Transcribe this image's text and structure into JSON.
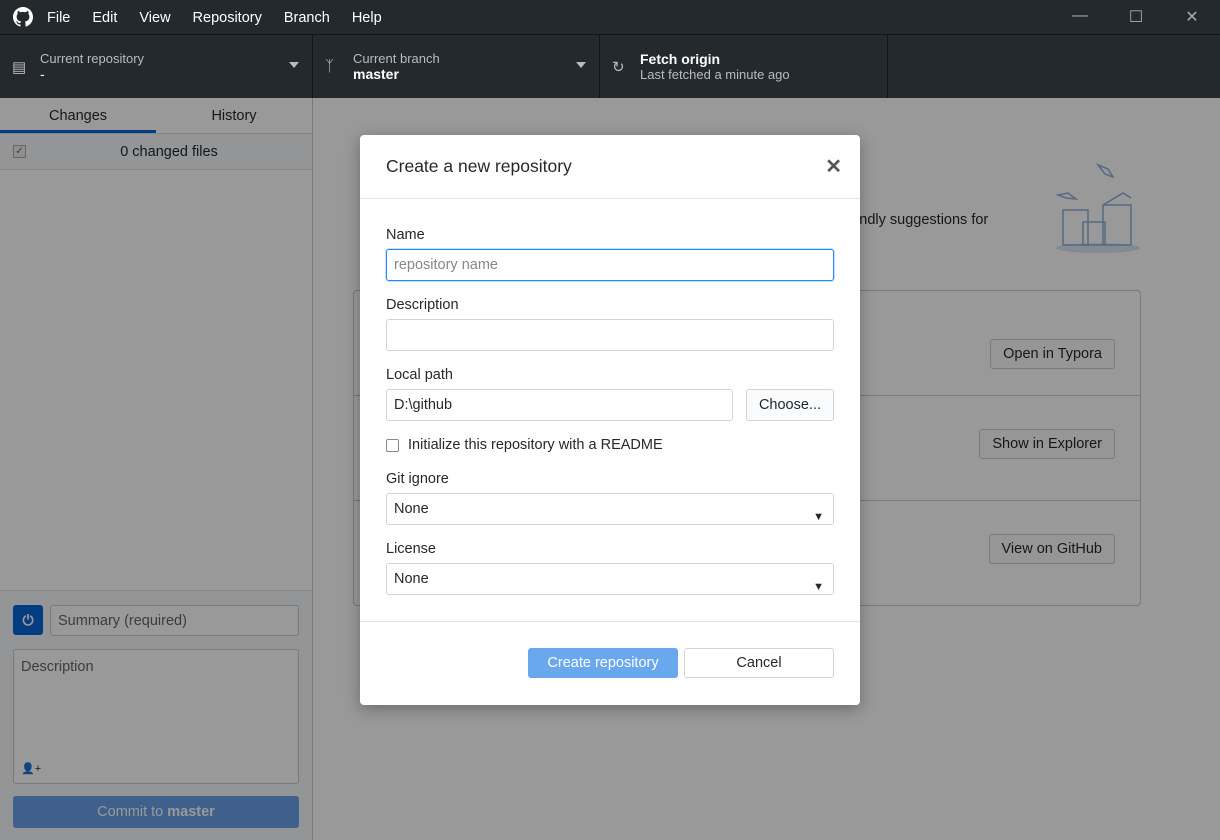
{
  "menu": [
    "File",
    "Edit",
    "View",
    "Repository",
    "Branch",
    "Help"
  ],
  "toolbar": {
    "repo": {
      "label": "Current repository",
      "value": "-"
    },
    "branch": {
      "label": "Current branch",
      "value": "master"
    },
    "fetch": {
      "label": "Fetch origin",
      "value": "Last fetched a minute ago"
    }
  },
  "sidebar": {
    "tabs": [
      "Changes",
      "History"
    ],
    "changed_files": "0 changed files",
    "summary_placeholder": "Summary (required)",
    "description_placeholder": "Description",
    "commit_prefix": "Commit to ",
    "commit_branch": "master"
  },
  "main": {
    "hint": "iendly suggestions for",
    "actions": [
      "Open in Typora",
      "Show in Explorer",
      "View on GitHub"
    ]
  },
  "dialog": {
    "title": "Create a new repository",
    "name_label": "Name",
    "name_placeholder": "repository name",
    "description_label": "Description",
    "path_label": "Local path",
    "path_value": "D:\\github",
    "choose": "Choose...",
    "readme": "Initialize this repository with a README",
    "gitignore_label": "Git ignore",
    "gitignore_value": "None",
    "license_label": "License",
    "license_value": "None",
    "create": "Create repository",
    "cancel": "Cancel"
  }
}
